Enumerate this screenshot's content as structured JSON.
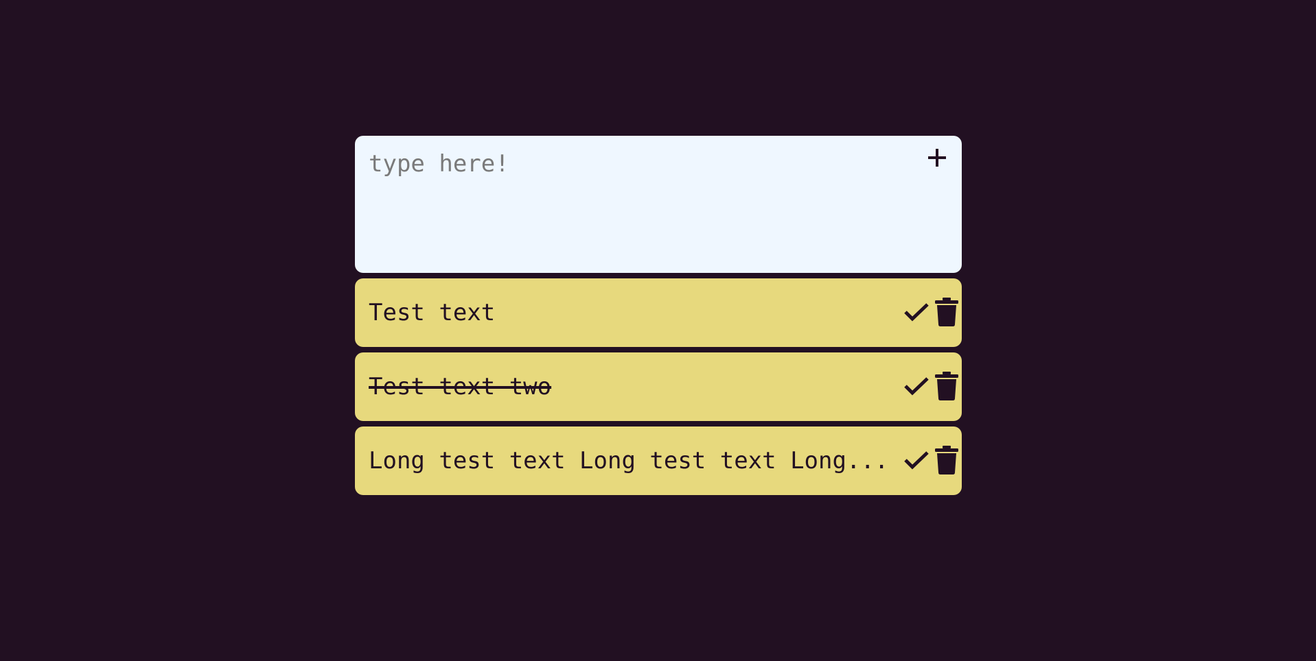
{
  "composer": {
    "placeholder": "type here!",
    "value": "",
    "add_icon": "plus-icon"
  },
  "todos": [
    {
      "text": "Test text",
      "completed": false
    },
    {
      "text": "Test text two",
      "completed": true
    },
    {
      "text": "Long test text Long test text Long...",
      "completed": false
    }
  ],
  "icons": {
    "complete": "check-icon",
    "delete": "trash-icon"
  },
  "colors": {
    "background": "#221022",
    "composer": "#eff7ff",
    "item": "#e7d97d",
    "ink": "#221022"
  }
}
